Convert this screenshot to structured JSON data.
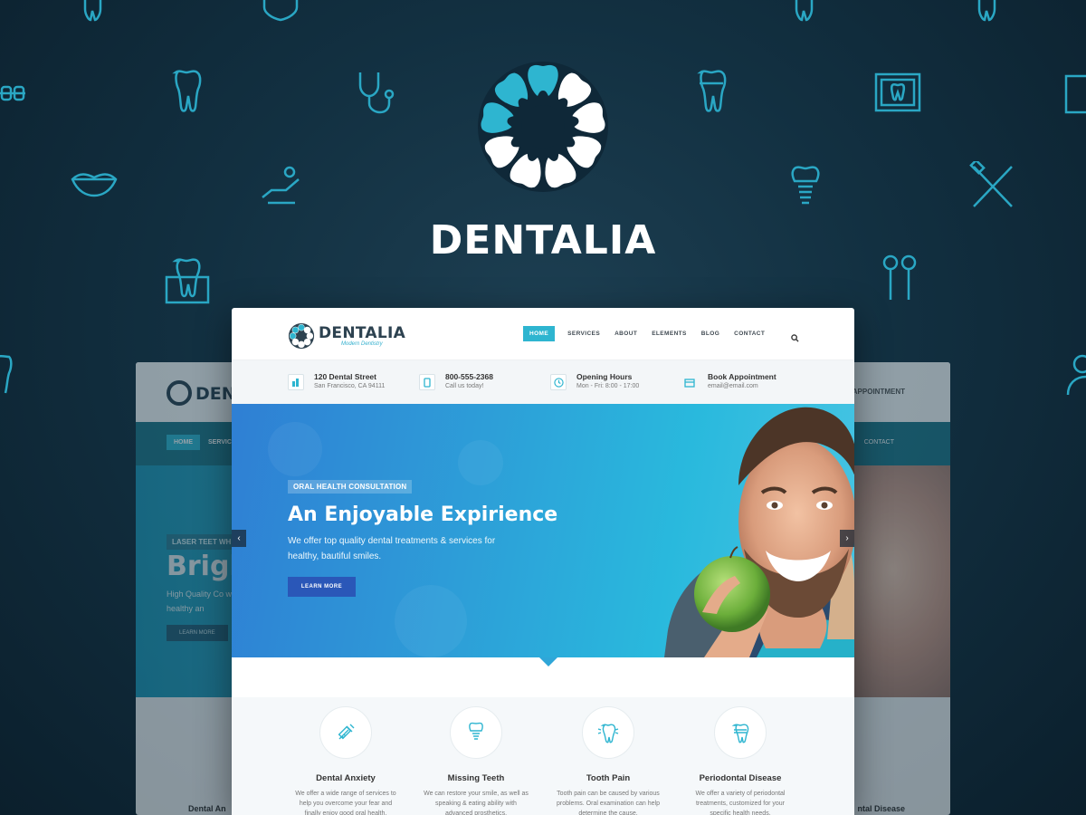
{
  "brand": {
    "name": "DENTALIA"
  },
  "back_mockup": {
    "logo": "DENT",
    "appointment": "OK APPOINTMENT",
    "nav_home": "HOME",
    "nav_services": "SERVICE",
    "nav_contact": "CONTACT",
    "hero_tag": "LASER TEET WH",
    "hero_title": "Brigh",
    "hero_sub": "High Quality Co with healthy an",
    "button": "LEARN MORE",
    "feature_left": "Dental An",
    "feature_right": "ntal Disease"
  },
  "site": {
    "logo_title": "DENTALIA",
    "logo_tagline": "Modern Dentistry",
    "nav": [
      "HOME",
      "SERVICES",
      "ABOUT",
      "ELEMENTS",
      "BLOG",
      "CONTACT"
    ],
    "info": [
      {
        "icon": "building-icon",
        "title": "120 Dental Street",
        "sub": "San Francisco, CA 94111"
      },
      {
        "icon": "phone-icon",
        "title": "800-555-2368",
        "sub": "Call us today!"
      },
      {
        "icon": "clock-icon",
        "title": "Opening Hours",
        "sub": "Mon - Fri: 8:00 - 17:00"
      },
      {
        "icon": "calendar-icon",
        "title": "Book Appointment",
        "sub": "email@email.com"
      }
    ],
    "hero": {
      "tag": "ORAL HEALTH CONSULTATION",
      "title": "An Enjoyable Expirience",
      "text": "We offer top quality dental treatments & services for healthy, bautiful smiles.",
      "button": "LEARN MORE"
    },
    "features": [
      {
        "icon": "syringe-icon",
        "title": "Dental Anxiety",
        "text": "We offer a wide range of services to help you overcome your fear and finally enjoy good oral health."
      },
      {
        "icon": "tooth-implant-icon",
        "title": "Missing Teeth",
        "text": "We can restore your smile, as well as speaking & eating ability with advanced prosthetics."
      },
      {
        "icon": "tooth-pain-icon",
        "title": "Tooth Pain",
        "text": "Tooth pain can be caused by various problems. Oral examination can help determine the cause."
      },
      {
        "icon": "tooth-crown-icon",
        "title": "Periodontal Disease",
        "text": "We offer a variety of periodontal treatments, customized for your specific health needs."
      }
    ]
  },
  "colors": {
    "accent": "#2eb5d0",
    "background": "#123041",
    "button": "#2a57b8"
  }
}
